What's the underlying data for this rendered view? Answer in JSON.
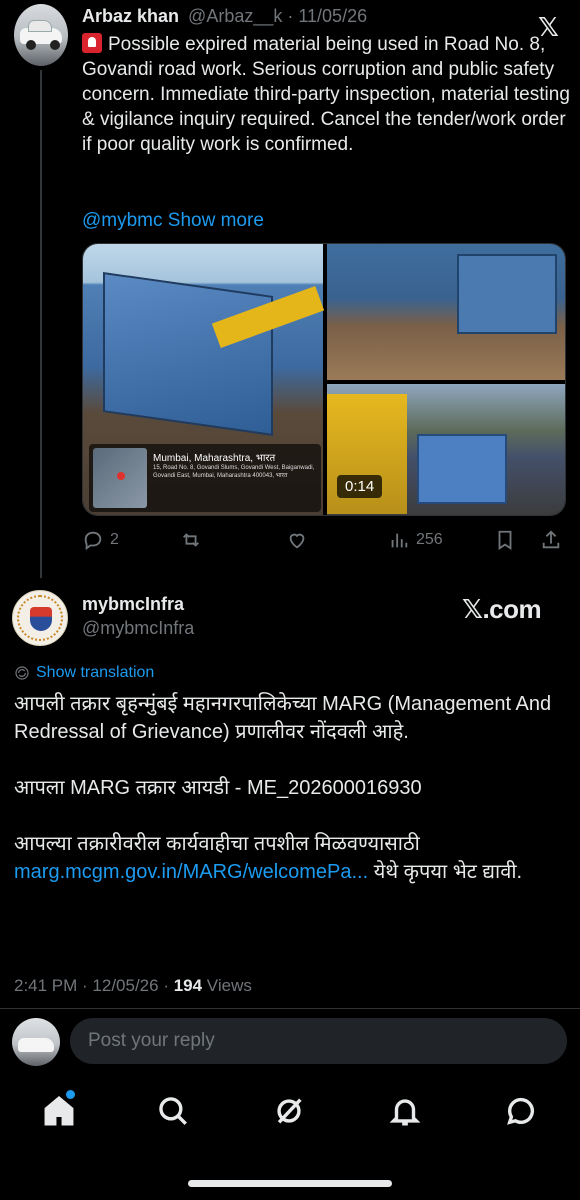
{
  "parent_tweet": {
    "author_name": "Arbaz khan",
    "handle_date": "@Arbaz__k · 11/05/26",
    "text": "Possible expired material being used in Road No. 8, Govandi road work. Serious corruption and public safety concern. Immediate third-party inspection, material testing & vigilance inquiry required. Cancel the tender/work order if poor quality work is confirmed.",
    "mention": "@mybmc",
    "show_more": "Show more",
    "geo_title": "Mumbai, Maharashtra, भारत",
    "geo_address": "15, Road No. 8, Govandi Slums, Govandi West, Baiganwadi, Govandi East, Mumbai, Maharashtra 400043, भारत",
    "video_duration": "0:14",
    "replies": "2",
    "views": "256"
  },
  "main_tweet": {
    "author_name": "mybmcInfra",
    "handle": "@mybmcInfra",
    "brand": "𝕏.com",
    "show_translation": "Show translation",
    "paragraph_1": "आपली तक्रार बृहन्मुंबई महानगरपालिकेच्या MARG (Management And Redressal of Grievance) प्रणालीवर नोंदवली आहे.",
    "paragraph_2": "आपला MARG तक्रार आयडी - ME_202600016930",
    "paragraph_3_prefix": "आपल्या तक्रारीवरील कार्यवाहीचा तपशील मिळवण्यासाठी ",
    "link": "marg.mcgm.gov.in/MARG/welcomePa...",
    "paragraph_3_suffix": " येथे कृपया भेट द्यावी.",
    "timestamp": "2:41 PM · 12/05/26 · ",
    "views_count": "194",
    "views_label": " Views"
  },
  "reply": {
    "placeholder": "Post your reply"
  },
  "nav": {
    "items": [
      "home-icon",
      "search-icon",
      "grok-icon",
      "notifications-icon",
      "messages-icon"
    ],
    "home_has_badge": true,
    "accent": "#1d9bf0"
  },
  "colors": {
    "background": "#000000",
    "text": "#e7e9ea",
    "muted": "#71767b",
    "link": "#1d9bf0"
  }
}
